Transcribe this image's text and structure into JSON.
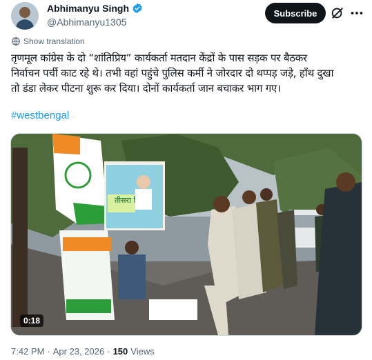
{
  "author": {
    "display_name": "Abhimanyu Singh",
    "handle": "@Abhimanyu1305",
    "avatar_icon": "user-avatar",
    "verified_icon": "verified-badge-icon",
    "verified_color": "#1d9bf0"
  },
  "actions": {
    "subscribe_label": "Subscribe",
    "grok_icon": "grok-icon",
    "more_icon": "more-dots-icon"
  },
  "translation": {
    "label": "Show translation",
    "icon": "globe-icon"
  },
  "tweet": {
    "lines": [
      "तृणमूल कांग्रेस के दो “शांतिप्रिय” कार्यकर्ता मतदान केंद्रों के पास सड़क पर बैठकर",
      "निर्वाचन पर्ची काट रहे थे। तभी वहां पहुंचे पुलिस कर्मी ने जोरदार दो थप्पड़ जड़े, हाँथ दुखा",
      "तो डंडा लेकर पीटना शुरू कर दिया। दोनों कार्यकर्ता जान बचाकर भाग गए।"
    ],
    "hashtag": "#westbengal"
  },
  "media": {
    "duration": "0:18",
    "poster_banner_text": "तीसरा\nदिन"
  },
  "meta": {
    "time": "7:42 PM",
    "separator": "·",
    "date": "Apr 23, 2026",
    "views_count": "150",
    "views_label": "Views"
  },
  "colors": {
    "accent": "#1d9bf0",
    "text_primary": "#0f1419",
    "text_secondary": "#536471",
    "subscribe_bg": "#0f1419"
  }
}
